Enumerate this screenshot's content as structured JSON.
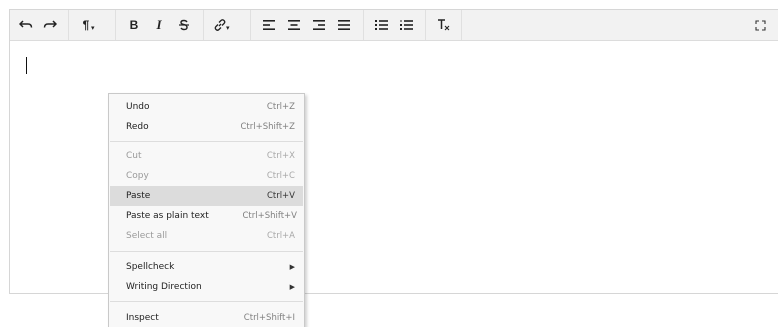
{
  "toolbar": {
    "buttons": [
      {
        "name": "undo",
        "icon": "undo-icon"
      },
      {
        "name": "redo",
        "icon": "redo-icon"
      },
      {
        "name": "paragraph-format",
        "icon": "pilcrow-icon",
        "glyph": "¶"
      },
      {
        "name": "bold",
        "icon": "bold-icon",
        "glyph": "B"
      },
      {
        "name": "italic",
        "icon": "italic-icon",
        "glyph": "I"
      },
      {
        "name": "strikethrough",
        "icon": "strikethrough-icon"
      },
      {
        "name": "link",
        "icon": "link-icon"
      },
      {
        "name": "align-left",
        "icon": "align-left-icon"
      },
      {
        "name": "align-center",
        "icon": "align-center-icon"
      },
      {
        "name": "align-right",
        "icon": "align-right-icon"
      },
      {
        "name": "justify",
        "icon": "align-justify-icon"
      },
      {
        "name": "bulleted-list",
        "icon": "bulleted-list-icon"
      },
      {
        "name": "numbered-list",
        "icon": "numbered-list-icon"
      },
      {
        "name": "clear-formatting",
        "icon": "clear-formatting-icon"
      },
      {
        "name": "fullscreen",
        "icon": "fullscreen-icon"
      }
    ]
  },
  "context_menu": {
    "items": [
      {
        "label": "Undo",
        "shortcut": "Ctrl+Z",
        "enabled": true
      },
      {
        "label": "Redo",
        "shortcut": "Ctrl+Shift+Z",
        "enabled": true
      },
      {
        "label": "Cut",
        "shortcut": "Ctrl+X",
        "enabled": false
      },
      {
        "label": "Copy",
        "shortcut": "Ctrl+C",
        "enabled": false
      },
      {
        "label": "Paste",
        "shortcut": "Ctrl+V",
        "enabled": true,
        "highlighted": true
      },
      {
        "label": "Paste as plain text",
        "shortcut": "Ctrl+Shift+V",
        "enabled": true
      },
      {
        "label": "Select all",
        "shortcut": "Ctrl+A",
        "enabled": false
      },
      {
        "label": "Spellcheck",
        "submenu": true,
        "enabled": true
      },
      {
        "label": "Writing Direction",
        "submenu": true,
        "enabled": true
      },
      {
        "label": "Inspect",
        "shortcut": "Ctrl+Shift+I",
        "enabled": true
      }
    ]
  },
  "colors": {
    "toolbar_bg": "#f2f2f2",
    "menu_bg": "#f8f8f8",
    "menu_highlight": "#dcdcdc",
    "disabled_text": "#9a9a9a"
  }
}
